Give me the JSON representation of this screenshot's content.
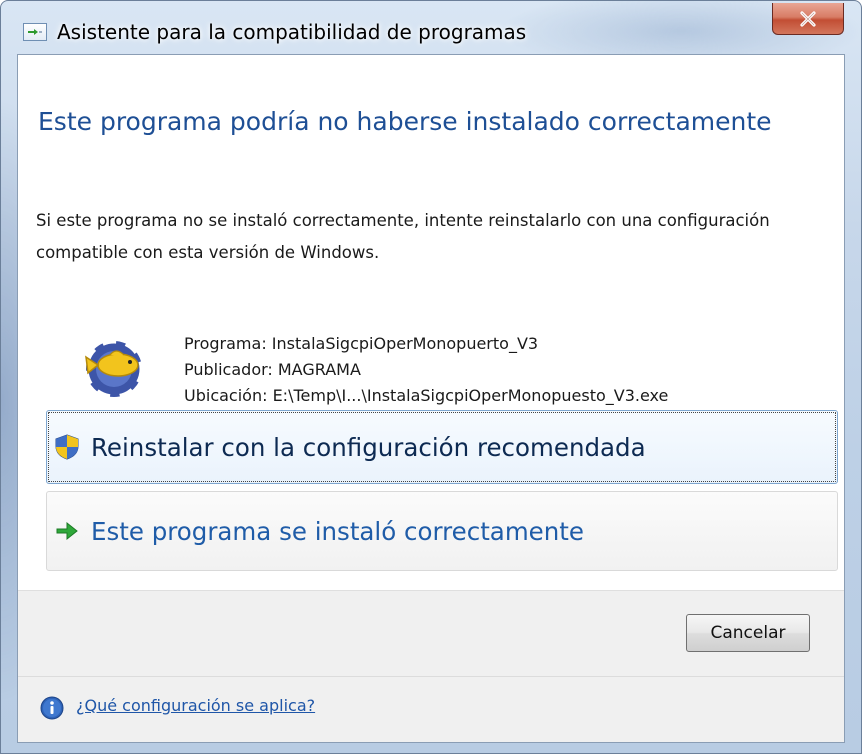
{
  "window": {
    "title": "Asistente para la compatibilidad de programas",
    "close_symbol": "✕",
    "icon": "program-window-icon"
  },
  "main": {
    "heading": "Este programa podría no haberse instalado correctamente",
    "description": "Si este programa no se instaló correctamente, intente reinstalarlo con una configuración compatible con esta versión de Windows.",
    "program_label": "Programa: InstalaSigcpiOperMonopuerto_V3",
    "publisher_label": "Publicador: MAGRAMA",
    "location_label": "Ubicación: E:\\Temp\\I...\\InstalaSigcpiOperMonopuesto_V3.exe",
    "app_icon": "application-icon"
  },
  "options": {
    "recommended": {
      "label": "Reinstalar con la configuración recomendada",
      "icon": "shield-icon"
    },
    "installed_ok": {
      "label": "Este programa se instaló correctamente",
      "icon": "green-arrow-icon"
    }
  },
  "buttons": {
    "cancel": "Cancelar"
  },
  "footer": {
    "help_link": "¿Qué configuración se aplica?",
    "icon": "info-icon"
  },
  "colors": {
    "heading": "#1e4f95",
    "link": "#1f56a8",
    "close_button": "#c24e34"
  }
}
